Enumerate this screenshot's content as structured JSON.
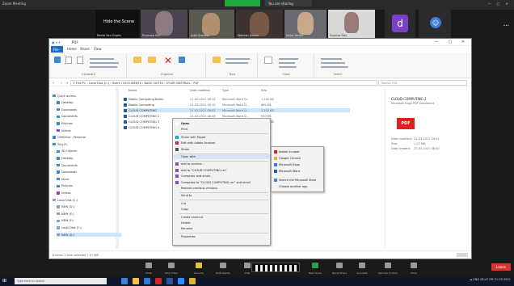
{
  "meeting": {
    "app_label": "Zoom Meeting",
    "share_status": "You are sharing",
    "more_label": "•••",
    "participants": [
      {
        "name": "Reeta Sen Gupta",
        "title": "Hide the Scene"
      },
      {
        "name": "Priyanka Rai"
      },
      {
        "name": "Aditi Sharma"
      },
      {
        "name": "Mahesh Kumar"
      },
      {
        "name": "Neha Verma"
      },
      {
        "name": "Supriya Das"
      },
      {
        "name": "d",
        "initial": "d"
      },
      {
        "name": "Guest",
        "initial": "☺"
      }
    ],
    "controls": [
      {
        "label": "Mute",
        "color": "#9a9a9a"
      },
      {
        "label": "Stop Video",
        "color": "#9a9a9a"
      },
      {
        "label": "Security",
        "color": "#e6c13a"
      },
      {
        "label": "Participants",
        "color": "#9a9a9a"
      },
      {
        "label": "Chat",
        "color": "#9a9a9a"
      },
      {
        "label": "New Share",
        "color": "#2f9e45"
      },
      {
        "label": "Pause Share",
        "color": "#9a9a9a"
      },
      {
        "label": "Annotate",
        "color": "#9a9a9a"
      },
      {
        "label": "Remote Control",
        "color": "#9a9a9a"
      },
      {
        "label": "More",
        "color": "#9a9a9a"
      }
    ],
    "leave_label": "Leave"
  },
  "explorer": {
    "title": "PDF",
    "ribbon_tabs": [
      "File",
      "Home",
      "Share",
      "View"
    ],
    "ribbon_groups": [
      "Clipboard",
      "Organize",
      "New",
      "Open",
      "Select"
    ],
    "path": "› This PC › Local Disk (C:) › Users › DOCUMENTS › BASIC NOTES › STUDY MATERIAL › PDF",
    "search_placeholder": "Search PDF",
    "nav": [
      {
        "label": "Quick access",
        "color": "#3b86d6"
      },
      {
        "label": "Desktop",
        "color": "#3b86d6"
      },
      {
        "label": "Downloads",
        "color": "#3b86d6"
      },
      {
        "label": "Documents",
        "color": "#3b86d6"
      },
      {
        "label": "Pictures",
        "color": "#3b86d6"
      },
      {
        "label": "Videos",
        "color": "#7a48c6"
      },
      {
        "label": "OneDrive - Personal",
        "color": "#3b86d6"
      },
      {
        "label": "This PC",
        "color": "#3b86d6"
      },
      {
        "label": "3D Objects",
        "color": "#3b86d6"
      },
      {
        "label": "Desktop",
        "color": "#3b86d6"
      },
      {
        "label": "Documents",
        "color": "#3b86d6"
      },
      {
        "label": "Downloads",
        "color": "#3b86d6"
      },
      {
        "label": "Music",
        "color": "#3b86d6"
      },
      {
        "label": "Pictures",
        "color": "#3b86d6"
      },
      {
        "label": "Videos",
        "color": "#7a48c6"
      },
      {
        "label": "Local Disk (C:)",
        "color": "#8aa0b6"
      },
      {
        "label": "NEW (D:)",
        "color": "#8aa0b6"
      },
      {
        "label": "NEW (E:)",
        "color": "#8aa0b6"
      },
      {
        "label": "NEW (F:)",
        "color": "#8aa0b6"
      },
      {
        "label": "Local Disk (C:)",
        "color": "#8aa0b6"
      },
      {
        "label": "NEW (D:)",
        "color": "#8aa0b6"
      }
    ],
    "columns": [
      "Name",
      "Date modified",
      "Type",
      "Size"
    ],
    "files": [
      {
        "name": "Mobile Computing Notes",
        "date": "21-03-2021 09:14",
        "type": "Microsoft Word D...",
        "size": "1,240 KB"
      },
      {
        "name": "Mobile Computing",
        "date": "21-03-2021 09:10",
        "type": "Microsoft Word D...",
        "size": "864 KB"
      },
      {
        "name": "CLOUD COMPUTING",
        "date": "21-03-2021 09:02",
        "type": "Microsoft Word D...",
        "size": "1,102 KB",
        "selected": true
      },
      {
        "name": "CLOUD COMPUTING 2",
        "date": "21-03-2021 08:58",
        "type": "Microsoft Word D...",
        "size": "990 KB"
      },
      {
        "name": "CLOUD COMPUTING 3",
        "date": "21-03-2021 08:51",
        "type": "Microsoft Word D...",
        "size": "1,040 KB"
      },
      {
        "name": "CLOUD COMPUTING 4",
        "date": "21-03-2021 08:47",
        "type": "Microsoft Word D...",
        "size": "720 KB"
      }
    ],
    "status": "6 items   1 item selected  1.07 MB",
    "preview": {
      "name": "CLOUD COMPUTING 2",
      "sub": "Microsoft Edge PDF Document",
      "badge": "PDF",
      "meta": [
        {
          "k": "Date modified:",
          "v": "21-03-2021 09:02"
        },
        {
          "k": "Size:",
          "v": "1.07 MB"
        },
        {
          "k": "Date created:",
          "v": "21-03-2021 08:40"
        }
      ]
    }
  },
  "context_menu": {
    "items": [
      {
        "label": "Open",
        "bold": true,
        "icon": "#ffffff"
      },
      {
        "label": "Print",
        "icon": ""
      },
      {
        "label": "Share with Skype",
        "icon": "#00a7e7"
      },
      {
        "label": "Edit with Adobe Acrobat",
        "icon": "#d32727"
      },
      {
        "label": "Share",
        "icon": "#555555"
      },
      {
        "label": "Open with",
        "icon": "",
        "arrow": "›",
        "highlight": true
      },
      {
        "label": "Add to archive...",
        "icon": "#8b4fb3"
      },
      {
        "label": "Add to \"CLOUD COMPUTING.rar\"",
        "icon": "#8b4fb3"
      },
      {
        "label": "Compress and email...",
        "icon": "#8b4fb3"
      },
      {
        "label": "Compress to \"CLOUD COMPUTING.rar\" and email",
        "icon": "#8b4fb3"
      },
      {
        "label": "Restore previous versions",
        "icon": ""
      },
      {
        "label": "Send to",
        "icon": "",
        "arrow": "›"
      },
      {
        "label": "Cut",
        "icon": ""
      },
      {
        "label": "Copy",
        "icon": ""
      },
      {
        "label": "Create shortcut",
        "icon": ""
      },
      {
        "label": "Delete",
        "icon": ""
      },
      {
        "label": "Rename",
        "icon": ""
      },
      {
        "label": "Properties",
        "icon": ""
      }
    ],
    "submenu": [
      {
        "label": "Adobe Acrobat",
        "icon": "#d32727"
      },
      {
        "label": "Google Chrome",
        "icon": "#e0b42b"
      },
      {
        "label": "Microsoft Edge",
        "icon": "#2b7bd9"
      },
      {
        "label": "Microsoft Word",
        "icon": "#2b579a"
      },
      {
        "label": "Search the Microsoft Store",
        "icon": "#3b86d6"
      },
      {
        "label": "Choose another app",
        "icon": ""
      }
    ]
  },
  "taskbar": {
    "search_placeholder": "Type here to search",
    "apps": [
      "#3b86d6",
      "#f2c24b",
      "#2b7bd9",
      "#d32727",
      "#2b579a",
      "#2d8cff",
      "#e0b42b"
    ],
    "tray": "☁ ENG 08:47 PM 21-03-2021"
  }
}
